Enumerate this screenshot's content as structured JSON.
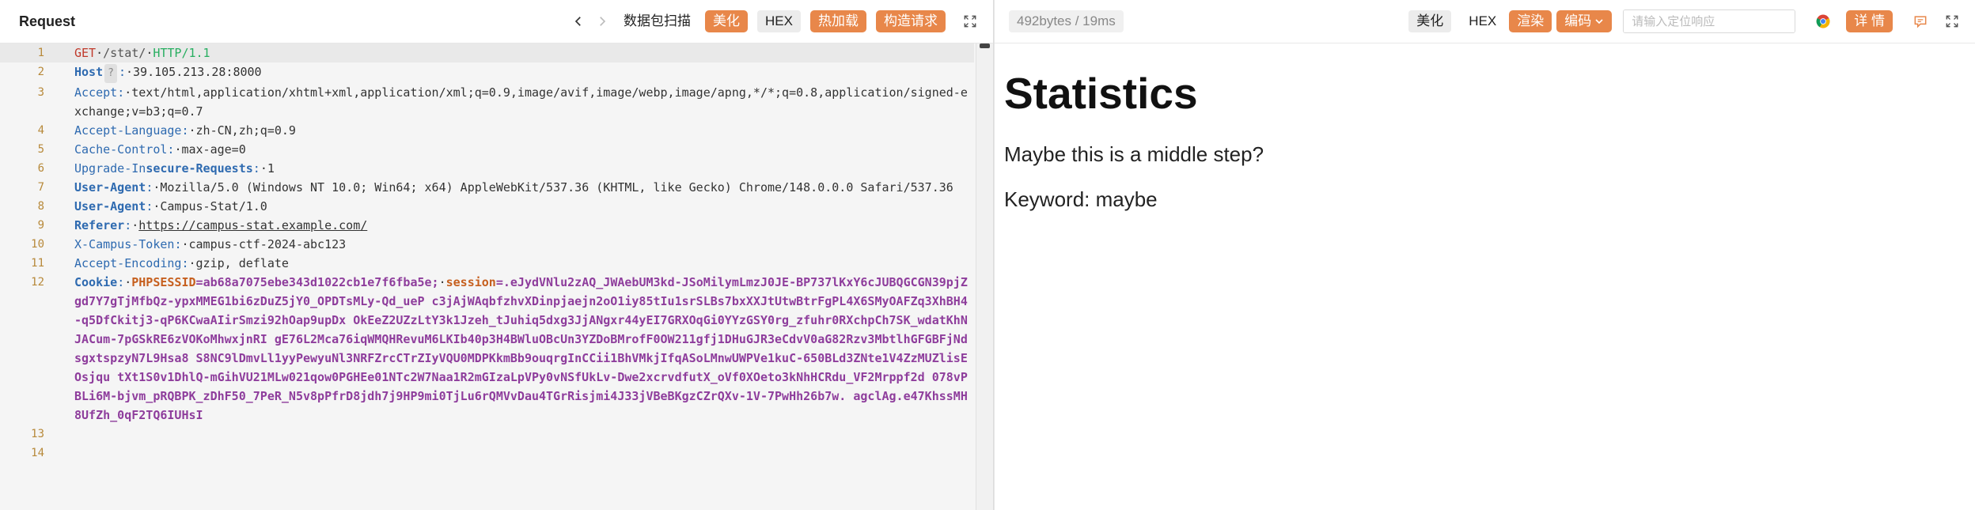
{
  "request": {
    "title": "Request",
    "buttons": {
      "scan": "数据包扫描",
      "beautify": "美化",
      "hex": "HEX",
      "hotload": "热加载",
      "construct": "构造请求"
    },
    "lines": [
      {
        "n": "1"
      },
      {
        "n": "2"
      },
      {
        "n": "3"
      },
      {
        "n": "4"
      },
      {
        "n": "5"
      },
      {
        "n": "6"
      },
      {
        "n": "7"
      },
      {
        "n": "8"
      },
      {
        "n": "9"
      },
      {
        "n": "10"
      },
      {
        "n": "11"
      },
      {
        "n": "12"
      },
      {
        "n": "13"
      },
      {
        "n": "14"
      }
    ],
    "method": "GET",
    "path": "/stat/",
    "proto": "HTTP/1.1",
    "host_name": "Host",
    "host_badge": "?",
    "host_val": "39.105.213.28:8000",
    "accept_name": "Accept",
    "accept_val": "text/html,application/xhtml+xml,application/xml;q=0.9,image/avif,image/webp,image/apng,*/*;q=0.8,application/signed-exchange;v=b3;q=0.7",
    "lang_name": "Accept-Language",
    "lang_val": "zh-CN,zh;q=0.9",
    "cache_name": "Cache-Control",
    "cache_val": "max-age=0",
    "upgrade_name_a": "Upgrade-In",
    "upgrade_name_b": "secure-Requests",
    "upgrade_val": "1",
    "ua_name": "User-Agent",
    "ua_val": "Mozilla/5.0 (Windows NT 10.0; Win64; x64) AppleWebKit/537.36 (KHTML, like Gecko) Chrome/148.0.0.0 Safari/537.36",
    "ua2_name": "User-Agent",
    "ua2_val": "Campus-Stat/1.0",
    "referer_name": "Referer",
    "referer_val": "https://campus-stat.example.com/",
    "token_name": "X-Campus-Token",
    "token_val": "campus-ctf-2024-abc123",
    "enc_name": "Accept-Encoding",
    "enc_val": "gzip, deflate",
    "cookie_name": "Cookie",
    "phpsess_name": "PHPSESSID",
    "phpsess_val": "ab68a7075ebe343d1022cb1e7f6fba5e",
    "session_name": "session",
    "session_val": ".eJydVNlu2zAQ_JWAebUM3kd-JSoMilymLmzJ0JE-BP737lKxY6cJUBQGCGN39pjZgd7Y7gTjMfbQz-ypxMMEG1bi6zDuZ5jY0_OPDTsMLy-Qd_ueP c3jAjWAqbfzhvXDinpjaejn2oO1iy85tIu1srSLBs7bxXXJtUtwBtrFgPL4X6SMyOAFZq3XhBH4-q5DfCkitj3-qP6KCwaAIirSmzi92hOap9upDx OkEeZ2UZzLtY3k1Jzeh_tJuhiq5dxg3JjANgxr44yEI7GRXOqGi0YYzGSY0rg_zfuhr0RXchpCh7SK_wdatKhNJACum-7pGSkRE6zVOKoMhwxjnRI gE76L2Mca76iqWMQHRevuM6LKIb40p3H4BWluOBcUn3YZDoBMrofF0OW211gfj1DHuGJR3eCdvV0aG82Rzv3MbtlhGFGBFjNdsgxtspzyN7L9Hsa8 S8NC9lDmvLl1yyPewyuNl3NRFZrcCTrZIyVQU0MDPKkmBb9ouqrgInCCii1BhVMkjIfqASoLMnwUWPVe1kuC-650BLd3ZNte1V4ZzMUZlisEOsjqu tXt1S0v1DhlQ-mGihVU21MLw021qow0PGHEe01NTc2W7Naa1R2mGIzaLpVPy0vNSfUkLv-Dwe2xcrvdfutX_oVf0XOeto3kNhHCRdu_VF2Mrppf2d 078vPBLi6M-bjvm_pRQBPK_zDhF50_7PeR_N5v8pPfrD8jdh7j9HP9mi0TjLu6rQMVvDau4TGrRisjmi4J33jVBeBKgzCZrQXv-1V-7PwHh26b7w. agclAg.e47KhssMH8UfZh_0qF2TQ6IUHsI"
  },
  "response": {
    "stats": "492bytes / 19ms",
    "buttons": {
      "beautify": "美化",
      "hex": "HEX",
      "render": "渲染",
      "encode": "编码",
      "detail": "详 情"
    },
    "search_placeholder": "请输入定位响应",
    "heading": "Statistics",
    "para1": "Maybe this is a middle step?",
    "para2": "Keyword: maybe"
  },
  "colors": {
    "accent": "#e8874a",
    "line_number": "#b7893a",
    "header_name": "#2e6ab0",
    "cookie_value": "#8e3d9c"
  },
  "icons": [
    "chevron-left-icon",
    "chevron-right-icon",
    "fullscreen-icon",
    "search-icon",
    "chevron-down-icon",
    "chrome-icon",
    "comment-icon"
  ]
}
